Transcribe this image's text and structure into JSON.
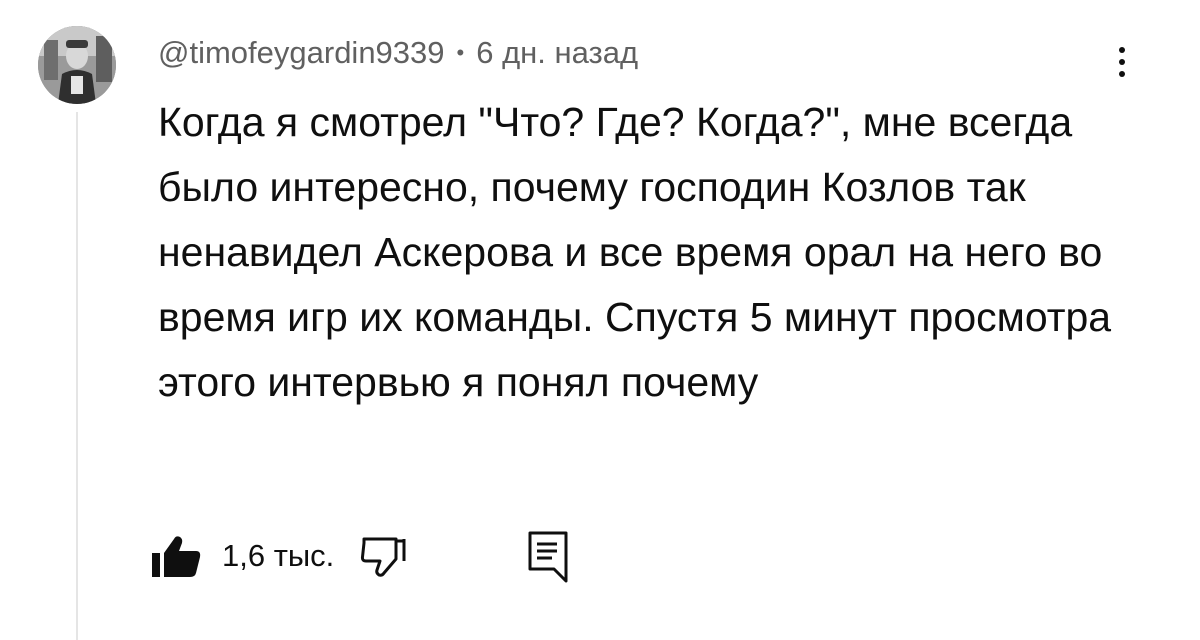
{
  "comment": {
    "author": "@timofeygardin9339",
    "separator": "•",
    "timestamp": "6 дн. назад",
    "text": "Когда я смотрел \"Что? Где? Когда?\", мне всегда было интересно, почему господин Козлов так ненавидел Аскерова и все время орал на него во время игр их команды. Спустя 5 минут просмотра этого интервью я понял почему",
    "like_count": "1,6 тыс.",
    "liked": true
  },
  "icons": {
    "like": "thumbs-up-filled-icon",
    "dislike": "thumbs-down-outline-icon",
    "reply": "comment-reply-icon",
    "menu": "more-vertical-icon"
  },
  "colors": {
    "text_primary": "#0f0f0f",
    "text_secondary": "#606060",
    "thread_line": "#e5e5e5"
  }
}
